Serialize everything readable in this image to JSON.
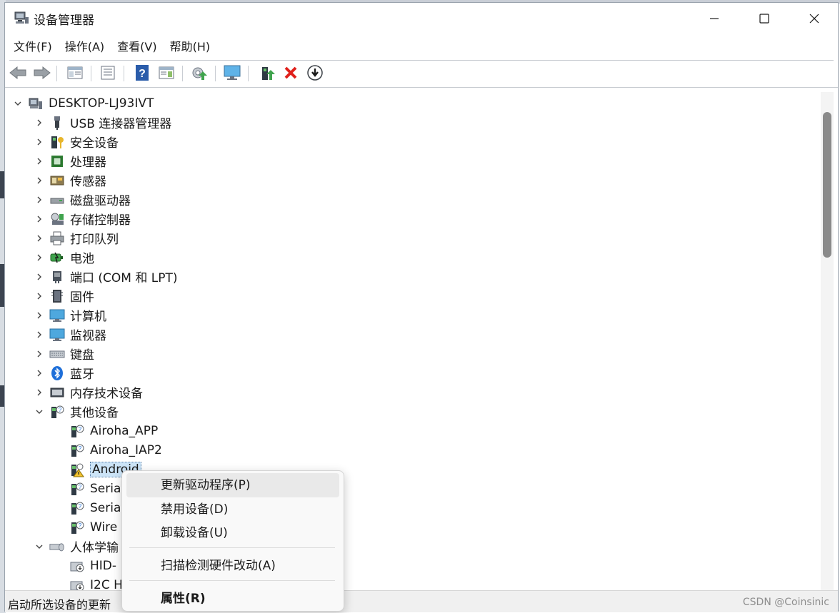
{
  "window": {
    "title": "设备管理器"
  },
  "menu": [
    "文件(F)",
    "操作(A)",
    "查看(V)",
    "帮助(H)"
  ],
  "toolbar": {
    "icons": [
      "back-icon",
      "forward-icon",
      "show-hide-console-tree-icon",
      "properties-icon",
      "help-icon",
      "action-pane-icon",
      "scan-hardware-icon",
      "monitor-icon",
      "update-driver-icon",
      "uninstall-icon",
      "disable-device-icon"
    ]
  },
  "tree": {
    "root": "DESKTOP-LJ93IVT",
    "items": [
      {
        "label": "USB 连接器管理器",
        "icon": "usb-icon"
      },
      {
        "label": "安全设备",
        "icon": "security-key-icon"
      },
      {
        "label": "处理器",
        "icon": "processor-icon"
      },
      {
        "label": "传感器",
        "icon": "sensor-icon"
      },
      {
        "label": "磁盘驱动器",
        "icon": "disk-drive-icon"
      },
      {
        "label": "存储控制器",
        "icon": "storage-controller-icon"
      },
      {
        "label": "打印队列",
        "icon": "printer-icon"
      },
      {
        "label": "电池",
        "icon": "battery-icon"
      },
      {
        "label": "端口 (COM 和 LPT)",
        "icon": "port-icon"
      },
      {
        "label": "固件",
        "icon": "firmware-icon"
      },
      {
        "label": "计算机",
        "icon": "computer-icon"
      },
      {
        "label": "监视器",
        "icon": "monitor-icon"
      },
      {
        "label": "键盘",
        "icon": "keyboard-icon"
      },
      {
        "label": "蓝牙",
        "icon": "bluetooth-icon"
      },
      {
        "label": "内存技术设备",
        "icon": "memory-device-icon"
      },
      {
        "label": "其他设备",
        "icon": "unknown-device-icon"
      }
    ],
    "other_devices": [
      {
        "label": "Airoha_APP",
        "icon": "unknown-device-icon"
      },
      {
        "label": "Airoha_IAP2",
        "icon": "unknown-device-icon"
      },
      {
        "label": "Android",
        "icon": "warning-device-icon"
      },
      {
        "label": "Seria",
        "icon": "unknown-device-icon"
      },
      {
        "label": "Seria",
        "icon": "unknown-device-icon"
      },
      {
        "label": "Wire",
        "icon": "unknown-device-icon"
      }
    ],
    "hid_group": {
      "label": "人体学输",
      "icon": "hid-icon"
    },
    "hid_children": [
      {
        "label": "HID-",
        "icon": "hid-device-icon"
      },
      {
        "label": "I2C H",
        "icon": "hid-device-icon"
      }
    ]
  },
  "context_menu": {
    "items": [
      "更新驱动程序(P)",
      "禁用设备(D)",
      "卸载设备(U)",
      "扫描检测硬件改动(A)",
      "属性(R)"
    ]
  },
  "statusbar": {
    "text": "启动所选设备的更新",
    "watermark": "CSDN @Coinsinic"
  }
}
